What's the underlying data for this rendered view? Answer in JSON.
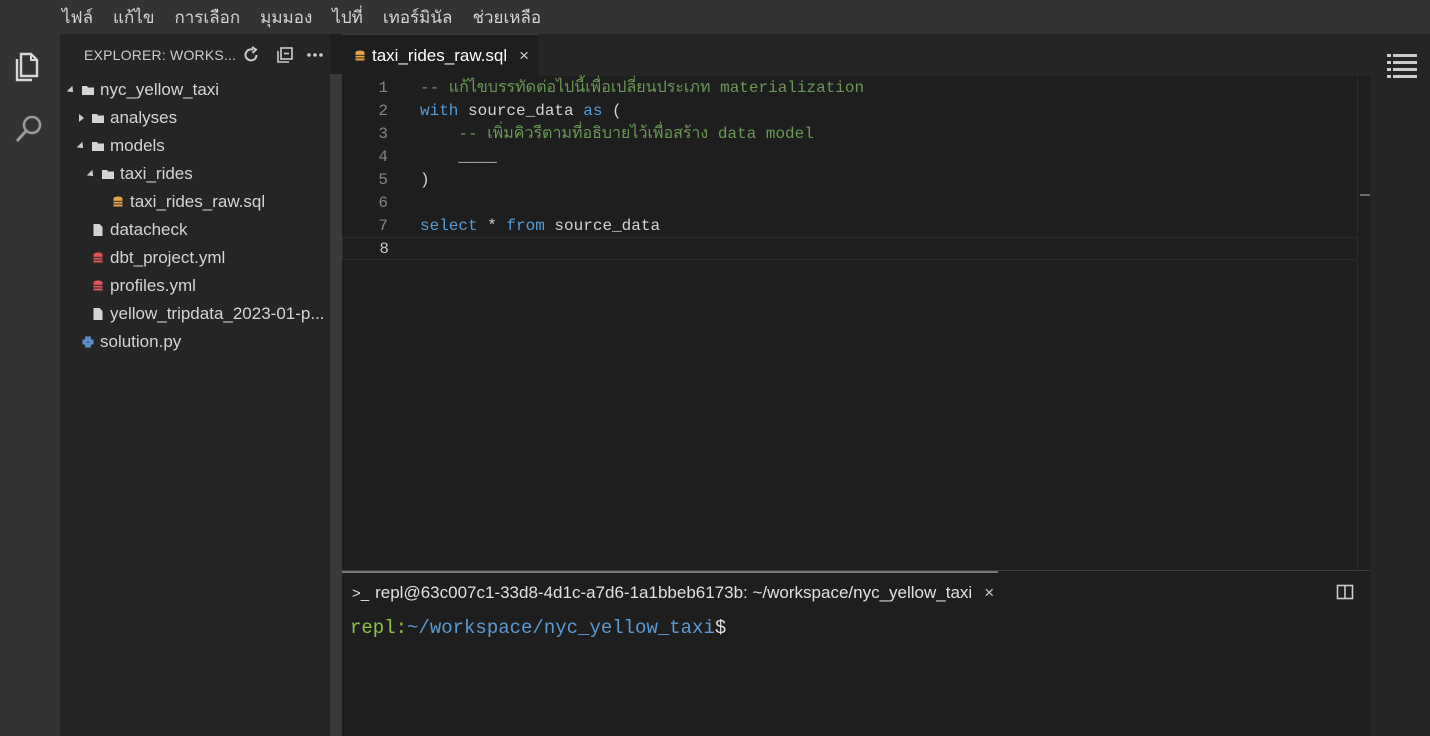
{
  "menu": [
    "ไฟล์",
    "แก้ไข",
    "การเลือก",
    "มุมมอง",
    "ไปที่",
    "เทอร์มินัล",
    "ช่วยเหลือ"
  ],
  "explorer": {
    "title": "EXPLORER: WORKS...",
    "tree": [
      {
        "label": "nyc_yellow_taxi",
        "kind": "folder",
        "expanded": true,
        "depth": 0
      },
      {
        "label": "analyses",
        "kind": "folder",
        "expanded": false,
        "depth": 1
      },
      {
        "label": "models",
        "kind": "folder",
        "expanded": true,
        "depth": 1
      },
      {
        "label": "taxi_rides",
        "kind": "folder",
        "expanded": true,
        "depth": 2
      },
      {
        "label": "taxi_rides_raw.sql",
        "kind": "sql",
        "depth": 3
      },
      {
        "label": "datacheck",
        "kind": "file",
        "depth": 1
      },
      {
        "label": "dbt_project.yml",
        "kind": "yml",
        "depth": 1
      },
      {
        "label": "profiles.yml",
        "kind": "yml",
        "depth": 1
      },
      {
        "label": "yellow_tripdata_2023-01-p...",
        "kind": "file",
        "depth": 1
      },
      {
        "label": "solution.py",
        "kind": "py",
        "depth": 0
      }
    ]
  },
  "editor": {
    "tab_label": "taxi_rides_raw.sql",
    "tab_close": "×",
    "line_numbers": [
      "1",
      "2",
      "3",
      "4",
      "5",
      "6",
      "7",
      "8"
    ],
    "lines": {
      "l1_comment": "-- แก้ไขบรรทัดต่อไปนี้เพื่อเปลี่ยนประเภท materialization",
      "l2_kw_with": "with",
      "l2_text": " source_data ",
      "l2_kw_as": "as",
      "l2_paren": " (",
      "l3_comment": "    -- เพิ่มคิวรีตามที่อธิบายไว้เพื่อสร้าง data model",
      "l4_blank": "    ____",
      "l5_close": ")",
      "l6_empty": "",
      "l7_kw_select": "select",
      "l7_star": " * ",
      "l7_kw_from": "from",
      "l7_text": " source_data",
      "l8_empty": ""
    }
  },
  "terminal": {
    "tab_prefix": ">_",
    "tab_label": "repl@63c007c1-33d8-4d1c-a7d6-1a1bbeb6173b: ~/workspace/nyc_yellow_taxi",
    "tab_close": "×",
    "prompt_user": "repl:",
    "prompt_path": "~/workspace/nyc_yellow_taxi",
    "prompt_symbol": "$"
  },
  "colors": {
    "keyword": "#569cd6",
    "comment": "#6a9955",
    "prompt_user": "#8bc34a",
    "prompt_path": "#5b9bd5",
    "sql_icon": "#e8a24a",
    "yml_icon": "#e05555",
    "py_icon": "#5b8ec7"
  },
  "icons": {
    "activity": [
      "files-icon",
      "search-icon"
    ],
    "explorer_header": [
      "refresh-icon",
      "collapse-all-icon",
      "more-icon"
    ],
    "right": [
      "minimap-icon"
    ]
  }
}
